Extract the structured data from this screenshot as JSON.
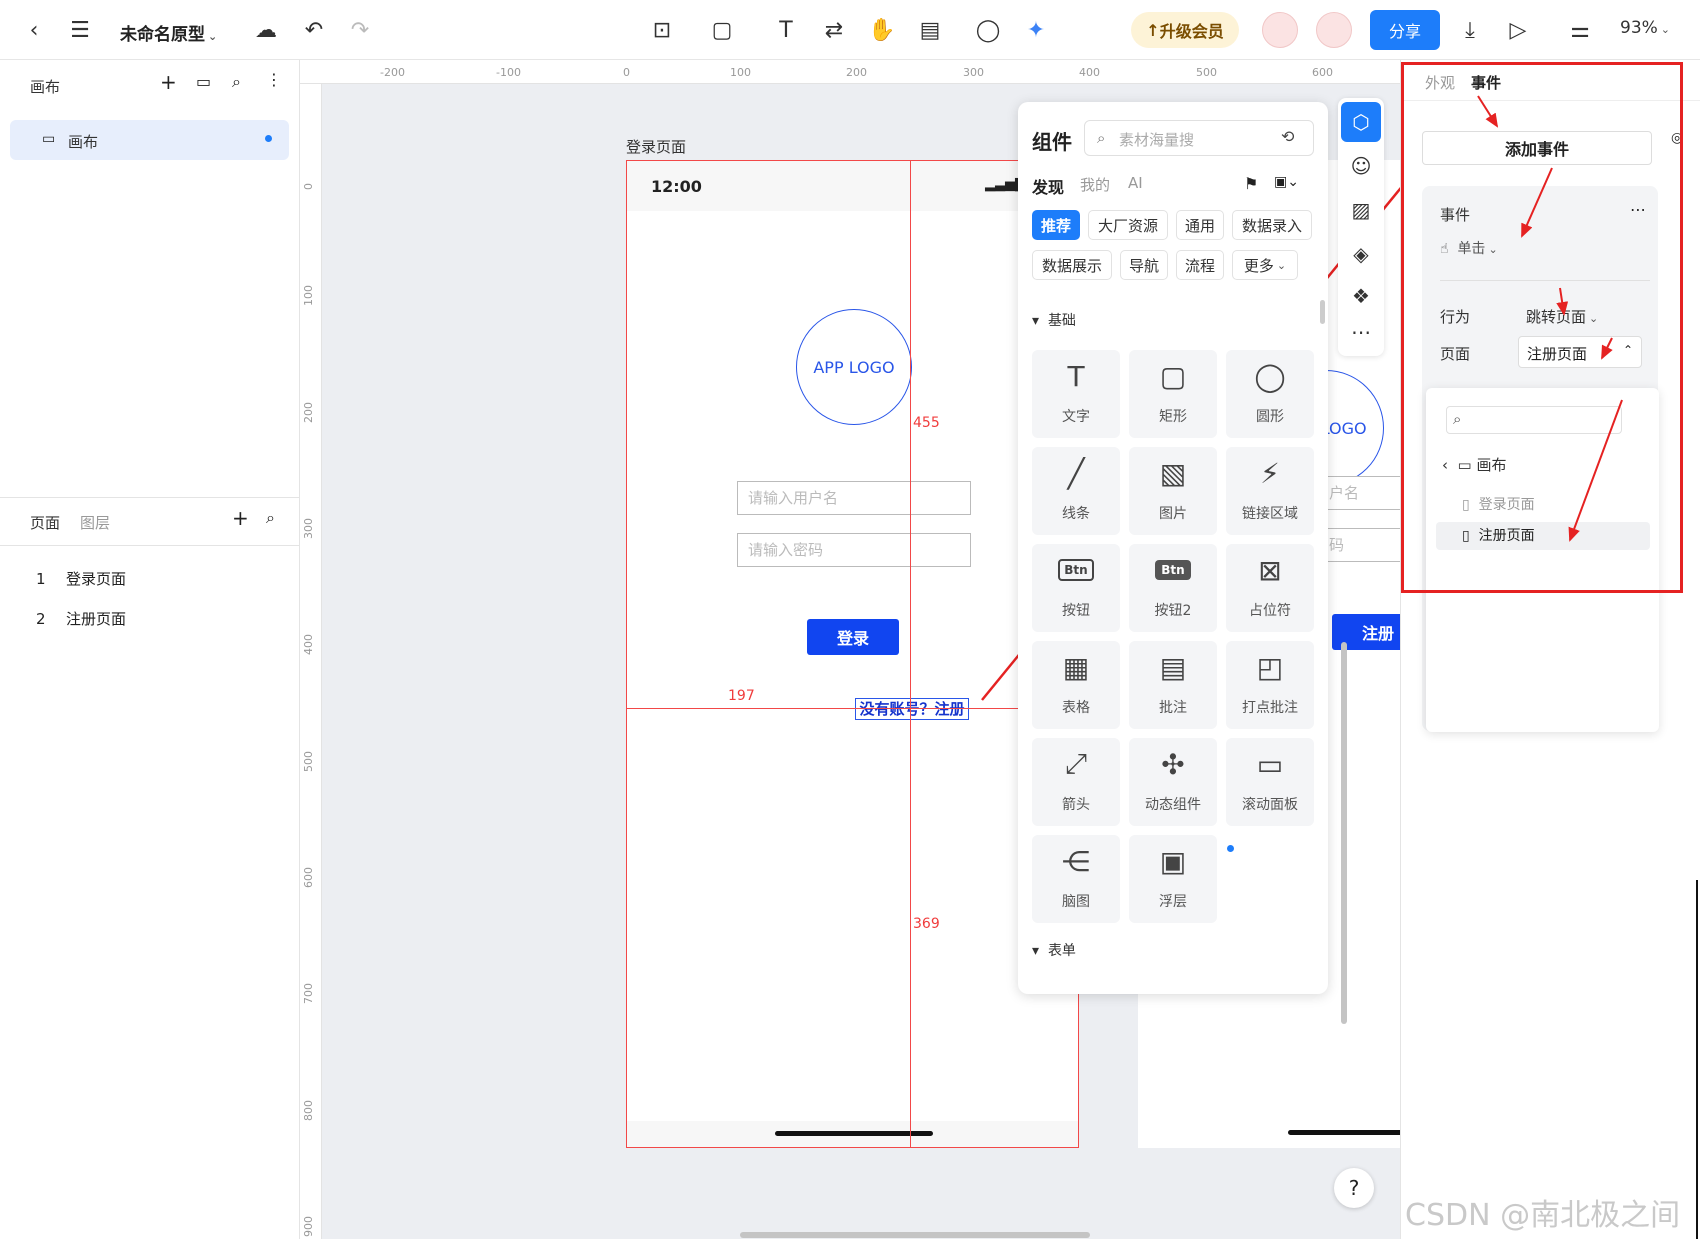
{
  "topbar": {
    "title": "未命名原型",
    "upgrade": "升级会员",
    "share": "分享",
    "zoom": "93%"
  },
  "left": {
    "canvas_section": "画布",
    "canvas_item": "画布",
    "tabs": [
      "页面",
      "图层"
    ],
    "pages": [
      {
        "num": "1",
        "name": "登录页面"
      },
      {
        "num": "2",
        "name": "注册页面"
      }
    ]
  },
  "canvas": {
    "hruler": [
      "-200",
      "-100",
      "0",
      "100",
      "200",
      "300",
      "400",
      "500",
      "600"
    ],
    "vruler": [
      "0",
      "100",
      "200",
      "300",
      "400",
      "500",
      "600",
      "700",
      "800",
      "900"
    ],
    "frame_label": "登录页面",
    "status_time": "12:00",
    "logo": "APP LOGO",
    "user_ph": "请输入用户名",
    "pwd_ph": "请输入密码",
    "login": "登录",
    "register_link": "没有账号？注册",
    "dist_top": "455",
    "dist_left": "197",
    "dist_bottom": "369",
    "frame2_logo": "APP LOGO",
    "frame2_user": "户名",
    "frame2_pwd": "码",
    "frame2_btn": "注册"
  },
  "components": {
    "title": "组件",
    "search_ph": "素材海量搜",
    "tabs": [
      "发现",
      "我的",
      "AI"
    ],
    "chips": [
      "推荐",
      "大厂资源",
      "通用",
      "数据录入",
      "数据展示",
      "导航",
      "流程",
      "更多"
    ],
    "section_basic": "基础",
    "section_form": "表单",
    "tiles": [
      "文字",
      "矩形",
      "圆形",
      "线条",
      "图片",
      "链接区域",
      "按钮",
      "按钮2",
      "占位符",
      "表格",
      "批注",
      "打点批注",
      "箭头",
      "动态组件",
      "滚动面板",
      "脑图",
      "浮层"
    ]
  },
  "right": {
    "tabs": [
      "外观",
      "事件"
    ],
    "add_event": "添加事件",
    "event_label": "事件",
    "trigger": "单击",
    "action_label": "行为",
    "action_value": "跳转页面",
    "page_label": "页面",
    "page_value": "注册页面",
    "tree_root": "画布",
    "tree_items": [
      "登录页面",
      "注册页面"
    ]
  },
  "help": "?",
  "watermark": "CSDN @南北极之间"
}
